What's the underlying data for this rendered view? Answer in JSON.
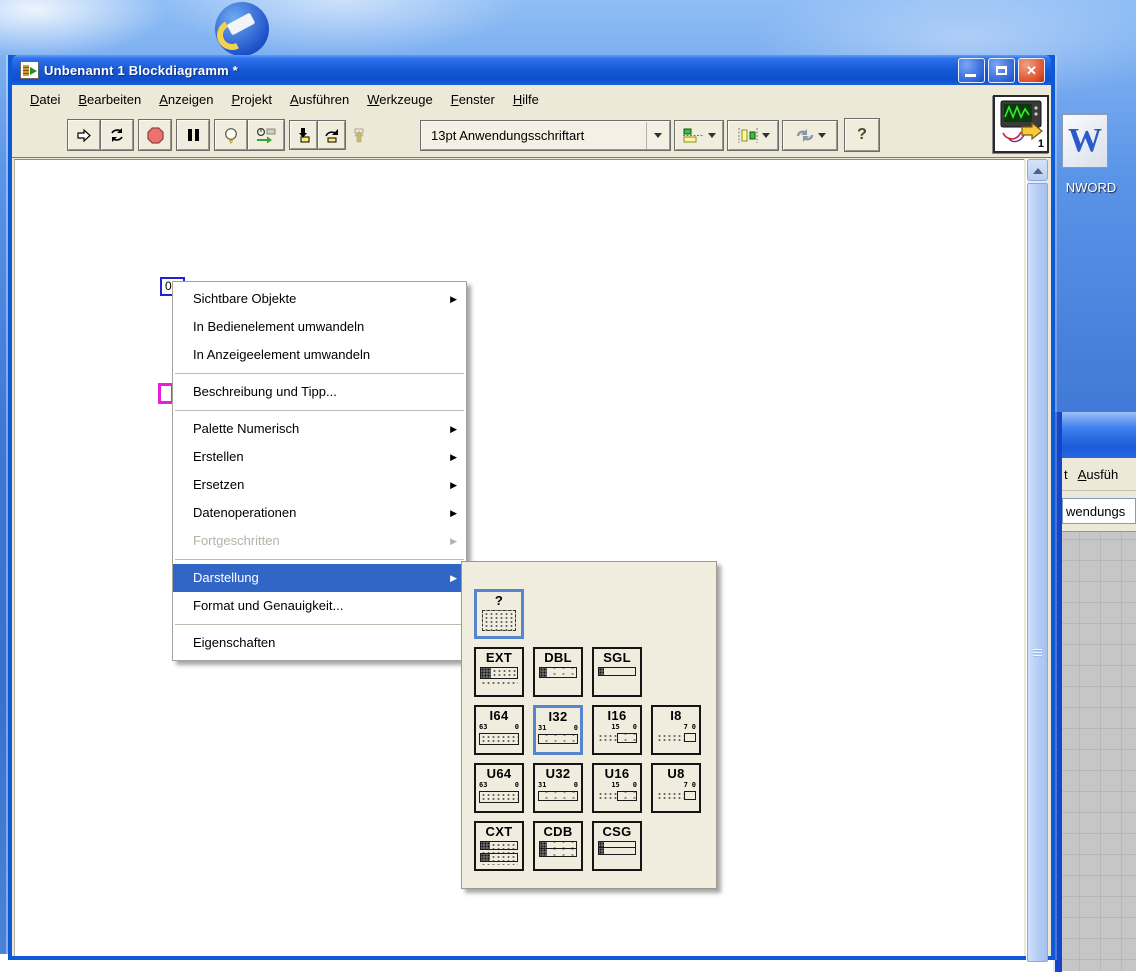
{
  "desktop": {
    "word_icon_letter": "W",
    "word_icon_label": "NWORD"
  },
  "window": {
    "title": "Unbenannt 1 Blockdiagramm *",
    "menu": [
      {
        "key": "D",
        "post": "atei"
      },
      {
        "key": "B",
        "post": "earbeiten"
      },
      {
        "key": "A",
        "post": "nzeigen"
      },
      {
        "key": "P",
        "post": "rojekt"
      },
      {
        "key": "A",
        "post": "usführen"
      },
      {
        "key": "W",
        "post": "erkzeuge"
      },
      {
        "key": "F",
        "post": "enster"
      },
      {
        "key": "H",
        "post": "ilfe"
      }
    ],
    "toolbar": {
      "font_selector": "13pt Anwendungsschriftart",
      "help_label": "?",
      "vi_number": "1"
    }
  },
  "diagram": {
    "numeric_constant": "0"
  },
  "context_menu": {
    "items": [
      {
        "label": "Sichtbare Objekte"
      },
      {
        "label": "In Bedienelement umwandeln"
      },
      {
        "label": "In Anzeigeelement umwandeln"
      },
      {
        "label": "Beschreibung und Tipp..."
      },
      {
        "label": "Palette Numerisch"
      },
      {
        "label": "Erstellen"
      },
      {
        "label": "Ersetzen"
      },
      {
        "label": "Datenoperationen"
      },
      {
        "label": "Fortgeschritten"
      },
      {
        "label": "Darstellung"
      },
      {
        "label": "Format und Genauigkeit..."
      },
      {
        "label": "Eigenschaften"
      }
    ]
  },
  "palette": {
    "cells": {
      "q": {
        "label": "?"
      },
      "ext": {
        "label": "EXT"
      },
      "dbl": {
        "label": "DBL"
      },
      "sgl": {
        "label": "SGL"
      },
      "i64": {
        "label": "I64",
        "bl": "63",
        "br": "0"
      },
      "i32": {
        "label": "I32",
        "bl": "31",
        "br": "0"
      },
      "i16": {
        "label": "I16",
        "bl": "15",
        "br": "0"
      },
      "i8": {
        "label": "I8",
        "bl": "7",
        "br": "0"
      },
      "u64": {
        "label": "U64",
        "bl": "63",
        "br": "0"
      },
      "u32": {
        "label": "U32",
        "bl": "31",
        "br": "0"
      },
      "u16": {
        "label": "U16",
        "bl": "15",
        "br": "0"
      },
      "u8": {
        "label": "U8",
        "bl": "7",
        "br": "0"
      },
      "cxt": {
        "label": "CXT"
      },
      "cdb": {
        "label": "CDB"
      },
      "csg": {
        "label": "CSG"
      }
    }
  },
  "background_window": {
    "menu_pre": "t   ",
    "menu_key": "A",
    "menu_post": "usfüh",
    "toolbar_fragment": "wendungs"
  },
  "icons": {
    "submenu_arrow": "▶",
    "close": "✕"
  },
  "colors": {
    "selection_blue": "#3166C6",
    "titlebar_blue": "#1659D6",
    "menu_beige": "#ECE9D8",
    "numeric_constant_border": "#2323D6",
    "string_constant_border": "#E620D8",
    "palette_selected_border": "#5585CC"
  }
}
